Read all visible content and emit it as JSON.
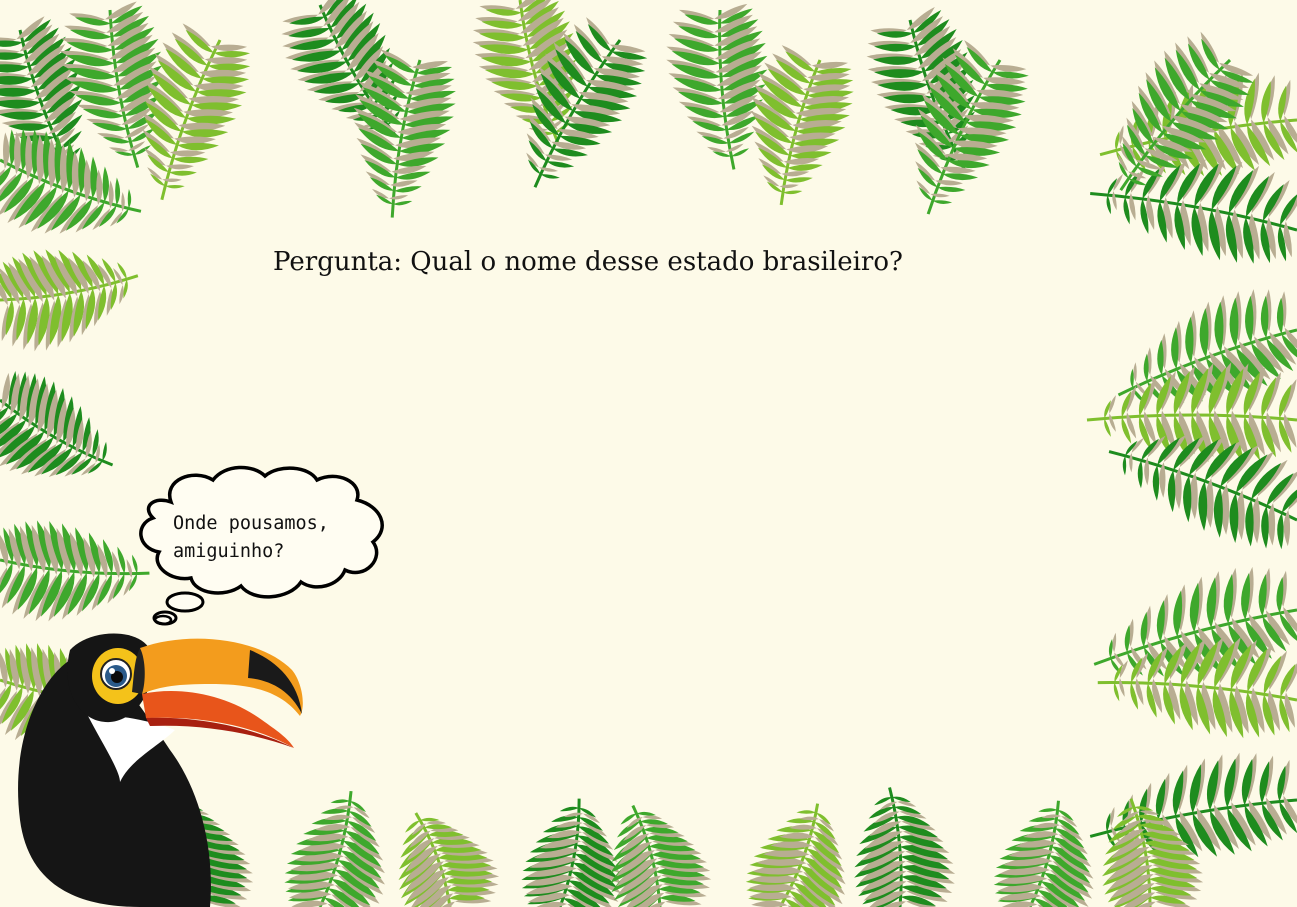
{
  "question": {
    "text": "Pergunta: Qual o nome desse estado brasileiro?"
  },
  "mascot": {
    "name": "toucan",
    "speech_line1": "Onde pousamos,",
    "speech_line2": "amiguinho?"
  },
  "colors": {
    "background": "#fdfae8",
    "leaf_dark": "#1e8c1e",
    "leaf_mid": "#3ea82c",
    "leaf_light": "#7fbf2e",
    "leaf_shadow": "#b8ad92",
    "beak_orange": "#f29a1c",
    "beak_red": "#d8401a"
  }
}
